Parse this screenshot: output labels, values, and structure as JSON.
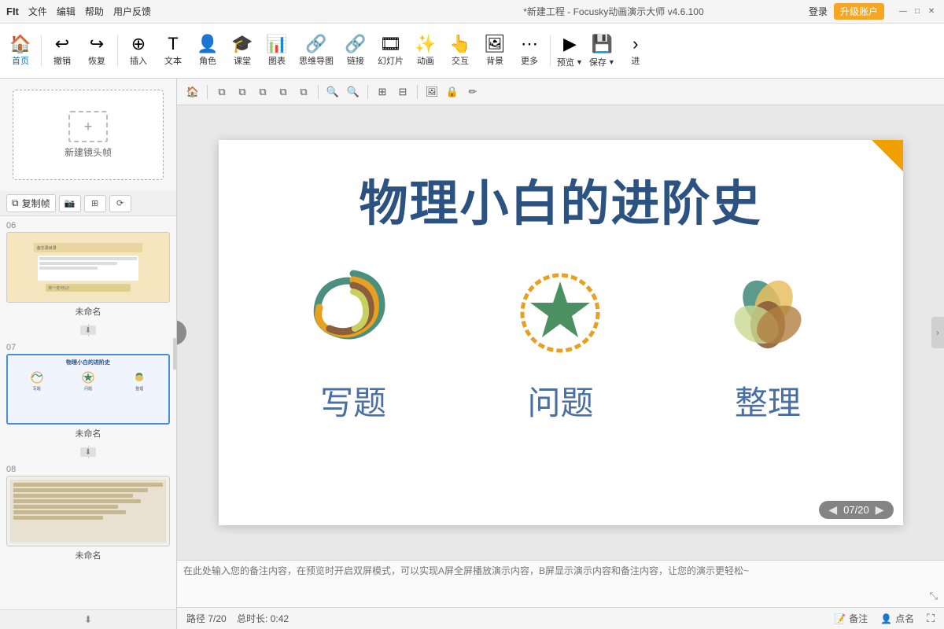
{
  "titlebar": {
    "logo": "FIt",
    "menus": [
      "文件",
      "编辑",
      "帮助",
      "用户反馈"
    ],
    "title": "*新建工程 - Focusky动画演示大师  v4.6.100",
    "login_label": "登录",
    "upgrade_label": "升级账户",
    "win_minimize": "—",
    "win_maximize": "□",
    "win_close": "✕"
  },
  "toolbar": {
    "home_label": "首页",
    "undo_label": "撤销",
    "redo_label": "恢复",
    "insert_label": "插入",
    "text_label": "文本",
    "role_label": "角色",
    "classroom_label": "课堂",
    "chart_label": "图表",
    "mindmap_label": "思维导图",
    "link_label": "链接",
    "slideshow_label": "幻灯片",
    "animation_label": "动画",
    "interact_label": "交互",
    "bg_label": "背景",
    "more_label": "更多",
    "preview_label": "预览",
    "save_label": "保存",
    "next_label": "进"
  },
  "canvas_toolbar": {
    "tools": [
      "🏠",
      "⧉",
      "⧉",
      "⧉",
      "⧉",
      "⧉",
      "🔍+",
      "🔍-",
      "⊞",
      "⊟",
      "🖼",
      "⊕",
      "✏"
    ]
  },
  "slides": [
    {
      "number": "06",
      "name": "未命名",
      "active": false
    },
    {
      "number": "07",
      "name": "未命名",
      "active": true
    },
    {
      "number": "08",
      "name": "未命名",
      "active": false
    }
  ],
  "slide07": {
    "title": "物理小白的进阶史",
    "icon1_label": "写题",
    "icon2_label": "问题",
    "icon3_label": "整理"
  },
  "sidebar": {
    "new_frame_label": "新建镜头帧",
    "copy_btn": "复制帧",
    "number_badge": "7"
  },
  "canvas": {
    "counter": "07/20",
    "corner_triangle_visible": true
  },
  "notes": {
    "placeholder": "在此处输入您的备注内容，在预览时开启双屏模式，可以实现A屏全屏播放演示内容，B屏显示演示内容和备注内容，让您的演示更轻松~"
  },
  "statusbar": {
    "path": "路径 7/20",
    "duration": "总时长: 0:42",
    "note_label": "备注",
    "point_label": "点名",
    "fullscreen": "⛶"
  }
}
